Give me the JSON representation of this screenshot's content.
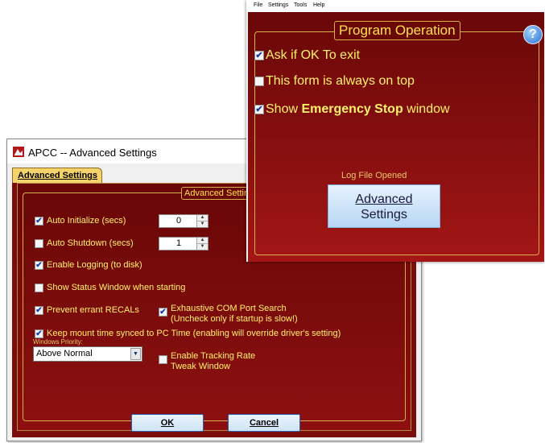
{
  "advanced_dialog": {
    "title": "APCC -- Advanced Settings",
    "tab_label": "Advanced Settings",
    "group_title": "Advanced Settings",
    "auto_initialize": {
      "label": "Auto Initialize (secs)",
      "checked": true,
      "value": "0"
    },
    "auto_shutdown": {
      "label": "Auto Shutdown (secs)",
      "checked": false,
      "value": "1"
    },
    "enable_logging": {
      "label": "Enable Logging (to disk)",
      "checked": true
    },
    "show_status_window": {
      "label": "Show Status Window when starting",
      "checked": false
    },
    "prevent_recals": {
      "label": "Prevent errant RECALs",
      "checked": true
    },
    "exhaustive_com": {
      "label_line1": "Exhaustive COM Port Search",
      "label_line2": "(Uncheck only if startup is slow!)",
      "checked": true
    },
    "keep_time_synced": {
      "label": "Keep mount time synced to PC Time (enabling will override driver's setting)",
      "checked": true
    },
    "windows_priority": {
      "label": "Windows Priority:",
      "value": "Above Normal"
    },
    "tracking_rate_tweak": {
      "label_line1": "Enable Tracking Rate",
      "label_line2": "Tweak Window",
      "checked": false
    },
    "ok_label": "OK",
    "cancel_label": "Cancel"
  },
  "main_window": {
    "menu": [
      "File",
      "Settings",
      "Tools",
      "Help"
    ],
    "group_title": "Program Operation",
    "help_symbol": "?",
    "ask_exit": {
      "label": "Ask if OK To exit",
      "checked": true
    },
    "always_on_top": {
      "label": "This form is always on top",
      "checked": false
    },
    "emergency_stop": {
      "label_pre": "Show ",
      "label_bold": "Emergency Stop",
      "label_post": " window",
      "checked": true
    },
    "log_status": "Log File Opened",
    "advanced_button": {
      "line1": "Advanced",
      "line2": "Settings"
    }
  },
  "colors": {
    "panel_red": "#7a0c0c",
    "label_yellow": "#fff26a",
    "legend_gold": "#d6b24a",
    "button_blue": "#cfe4f7"
  }
}
